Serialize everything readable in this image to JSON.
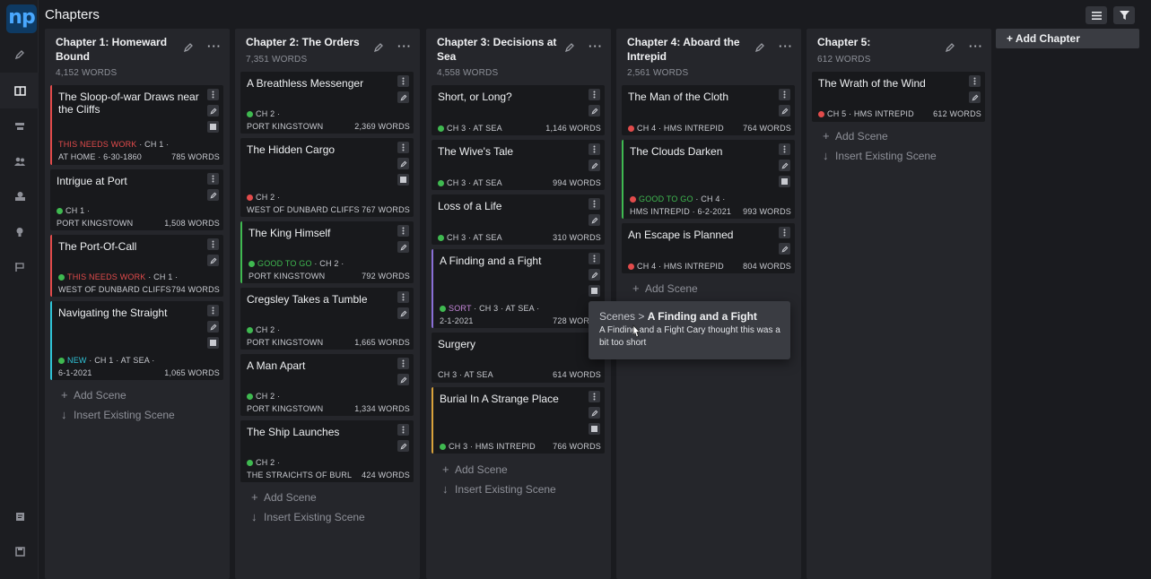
{
  "app": {
    "logo": "np",
    "title": "Chapters"
  },
  "sidebar": {
    "items": [
      {
        "icon": "pen-icon"
      },
      {
        "icon": "board-icon",
        "active": true
      },
      {
        "icon": "timeline-icon"
      },
      {
        "icon": "people-icon"
      },
      {
        "icon": "locations-icon"
      },
      {
        "icon": "lightbulb-icon"
      },
      {
        "icon": "flag-icon"
      }
    ],
    "bottom": [
      {
        "icon": "notes-icon"
      },
      {
        "icon": "save-icon"
      }
    ]
  },
  "toolbar": {
    "list_icon": "list-icon",
    "filter_icon": "filter-icon"
  },
  "add_chapter_label": "+ Add Chapter",
  "colors": {
    "red": "#e24b4b",
    "green": "#3fb950",
    "teal": "#2fc3d6",
    "purple": "#8a6fd6",
    "orange": "#d9a23b"
  },
  "columns": [
    {
      "title": "Chapter 1: Homeward Bound",
      "words": "4,152 WORDS",
      "cards": [
        {
          "title": "The Sloop-of-war Draws near the Cliffs",
          "status": "THIS NEEDS WORK",
          "status_color": "#e24b4b",
          "meta1_rest": " · CH 1 ·",
          "meta2": "AT HOME · 6-30-1860",
          "words": "785 WORDS",
          "dot": ""
        },
        {
          "title": "Intrigue at Port",
          "meta1": "CH 1 ·",
          "meta2": "PORT KINGSTOWN",
          "words": "1,508 WORDS",
          "dot": "#3fb950"
        },
        {
          "title": "The Port-Of-Call",
          "status": "THIS NEEDS WORK",
          "status_color": "#e24b4b",
          "meta1_rest": " · CH 1 ·",
          "meta2": "WEST OF DUNBARD CLIFFS",
          "words": "794 WORDS",
          "dot": "#3fb950"
        },
        {
          "title": "Navigating the Straight",
          "status": "NEW",
          "status_color": "#2fc3d6",
          "meta1_rest": " · CH 1 · AT SEA ·",
          "meta2": "6-1-2021",
          "words": "1,065 WORDS",
          "dot": "#3fb950"
        }
      ],
      "add_scene": "Add Scene",
      "insert_scene": "Insert Existing Scene"
    },
    {
      "title": "Chapter 2: The Orders",
      "words": "7,351 WORDS",
      "cards": [
        {
          "title": "A Breathless Messenger",
          "meta1": "CH 2 ·",
          "meta2": "PORT KINGSTOWN",
          "words": "2,369 WORDS",
          "dot": "#3fb950"
        },
        {
          "title": "The Hidden Cargo",
          "meta1": "CH 2 ·",
          "meta2": "WEST OF DUNBARD CLIFFS",
          "words": "767 WORDS",
          "dot": "#e24b4b"
        },
        {
          "title": "The King Himself",
          "status": "GOOD TO GO",
          "status_color": "#3fb950",
          "meta1_rest": " · CH 2 ·",
          "meta2": "PORT KINGSTOWN",
          "words": "792 WORDS",
          "dot": "#3fb950"
        },
        {
          "title": "Cregsley Takes a Tumble",
          "meta1": "CH 2 ·",
          "meta2": "PORT KINGSTOWN",
          "words": "1,665 WORDS",
          "dot": "#3fb950"
        },
        {
          "title": "A Man Apart",
          "meta1": "CH 2 ·",
          "meta2": "PORT KINGSTOWN",
          "words": "1,334 WORDS",
          "dot": "#3fb950"
        },
        {
          "title": "The Ship Launches",
          "meta1": "CH 2 ·",
          "meta2": "THE STRAICHTS OF BURL",
          "words": "424 WORDS",
          "dot": "#3fb950"
        }
      ],
      "add_scene": "Add Scene",
      "insert_scene": "Insert Existing Scene"
    },
    {
      "title": "Chapter 3: Decisions at Sea",
      "words": "4,558 WORDS",
      "cards": [
        {
          "title": "Short, or Long?",
          "meta1": "CH 3 · AT SEA",
          "words": "1,146 WORDS",
          "dot": "#3fb950"
        },
        {
          "title": "The Wive's Tale",
          "meta1": "CH 3 · AT SEA",
          "words": "994 WORDS",
          "dot": "#3fb950"
        },
        {
          "title": "Loss of a Life",
          "meta1": "CH 3 · AT SEA",
          "words": "310 WORDS",
          "dot": "#3fb950"
        },
        {
          "title": "A Finding and a Fight",
          "status": "SORT",
          "status_color": "#c586d9",
          "meta1_rest": " · CH 3 · AT SEA ·",
          "meta2": "2-1-2021",
          "words": "728 WORDS",
          "dot": "#3fb950"
        },
        {
          "title": "Surgery",
          "meta1": "CH 3 · AT SEA",
          "words": "614 WORDS",
          "dot": ""
        },
        {
          "title": "Burial In A Strange Place",
          "meta1": "CH 3 · HMS INTREPID",
          "words": "766 WORDS",
          "dot": "#3fb950"
        }
      ],
      "add_scene": "Add Scene",
      "insert_scene": "Insert Existing Scene"
    },
    {
      "title": "Chapter 4: Aboard the Intrepid",
      "words": "2,561 WORDS",
      "cards": [
        {
          "title": "The Man of the Cloth",
          "meta1": "CH 4 · HMS INTREPID",
          "words": "764 WORDS",
          "dot": "#e24b4b"
        },
        {
          "title": "The Clouds Darken",
          "status": "GOOD TO GO",
          "status_color": "#3fb950",
          "meta1_rest": " · CH 4 ·",
          "meta2": "HMS INTREPID · 6-2-2021",
          "words": "993 WORDS",
          "dot": "#e24b4b"
        },
        {
          "title": "An Escape is Planned",
          "meta1": "CH 4 · HMS INTREPID",
          "words": "804 WORDS",
          "dot": "#e24b4b"
        }
      ],
      "add_scene": "Add Scene"
    },
    {
      "title": "Chapter 5:",
      "words": "612 WORDS",
      "cards": [
        {
          "title": "The Wrath of the Wind",
          "meta1": "CH 5 · HMS INTREPID",
          "words": "612 WORDS",
          "dot": "#e24b4b"
        }
      ],
      "add_scene": "Add Scene",
      "insert_scene": "Insert Existing Scene"
    }
  ],
  "tooltip": {
    "crumb": "Scenes >",
    "title": "A Finding and a Fight",
    "body": "A Finding and a Fight Cary thought this was a bit too short"
  }
}
